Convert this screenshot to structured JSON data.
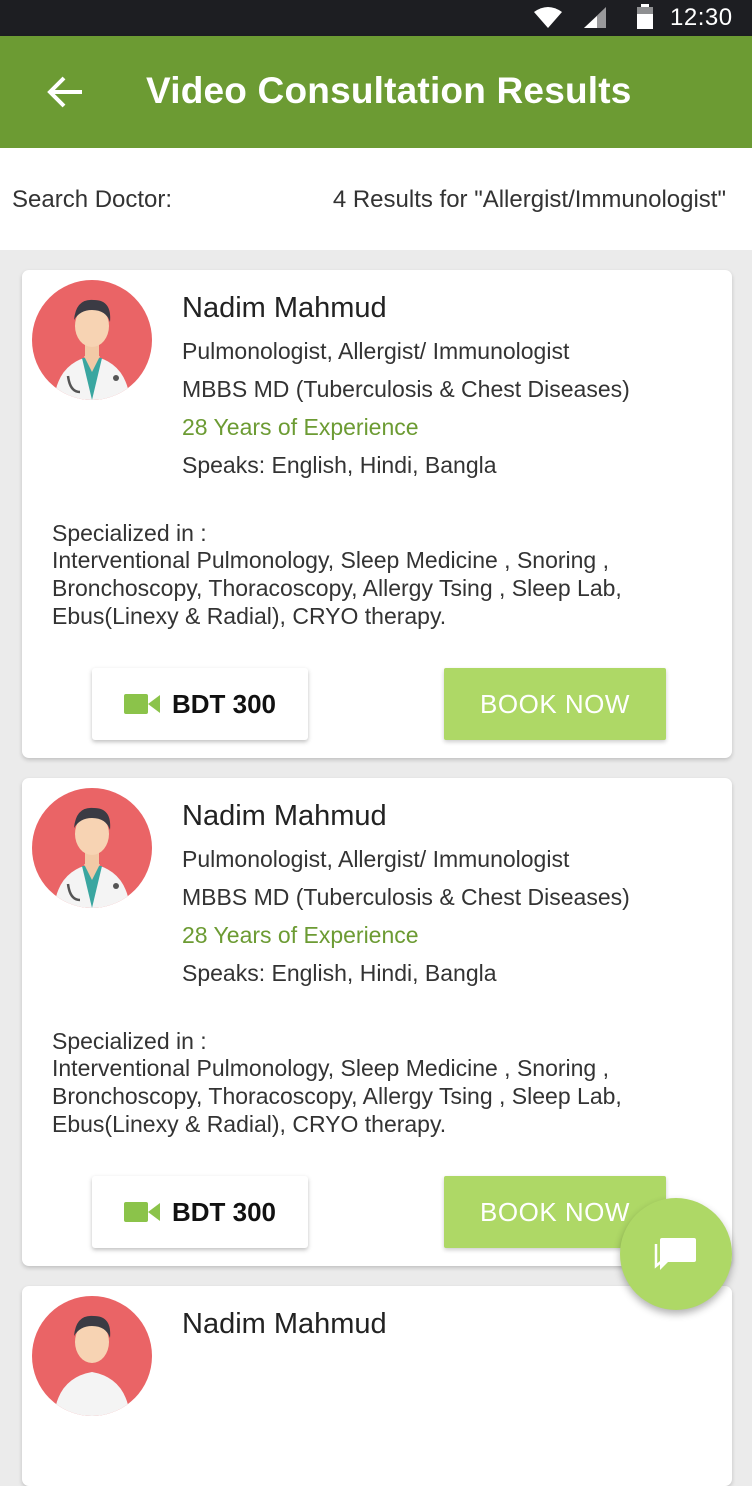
{
  "status_bar": {
    "time": "12:30"
  },
  "app_bar": {
    "title": "Video Consultation Results"
  },
  "search": {
    "label": "Search Doctor:",
    "results_text": "4 Results for \"Allergist/Immunologist\""
  },
  "doctors": [
    {
      "name": "Nadim Mahmud",
      "specialty": "Pulmonologist, Allergist/ Immunologist",
      "degree": "MBBS MD (Tuberculosis & Chest Diseases)",
      "experience": "28 Years of Experience",
      "languages": "Speaks: English, Hindi, Bangla",
      "specialized_label": "Specialized in :",
      "specialized_text": "Interventional Pulmonology, Sleep Medicine , Snoring , Bronchoscopy, Thoracoscopy, Allergy Tsing , Sleep Lab, Ebus(Linexy & Radial), CRYO therapy.",
      "fee": "BDT 300",
      "book_label": "BOOK NOW"
    },
    {
      "name": "Nadim Mahmud",
      "specialty": "Pulmonologist, Allergist/ Immunologist",
      "degree": "MBBS MD (Tuberculosis & Chest Diseases)",
      "experience": "28 Years of Experience",
      "languages": "Speaks: English, Hindi, Bangla",
      "specialized_label": "Specialized in :",
      "specialized_text": "Interventional Pulmonology, Sleep Medicine , Snoring , Bronchoscopy, Thoracoscopy, Allergy Tsing , Sleep Lab, Ebus(Linexy & Radial), CRYO therapy.",
      "fee": "BDT 300",
      "book_label": "BOOK NOW"
    },
    {
      "name": "Nadim Mahmud"
    }
  ],
  "colors": {
    "app_bar": "#6c9b33",
    "accent_green": "#aed866",
    "experience_text": "#6c9b33",
    "avatar_bg": "#ea6466"
  },
  "icons": [
    "back-arrow-icon",
    "wifi-icon",
    "signal-icon",
    "battery-icon",
    "video-camera-icon",
    "chat-icon"
  ]
}
